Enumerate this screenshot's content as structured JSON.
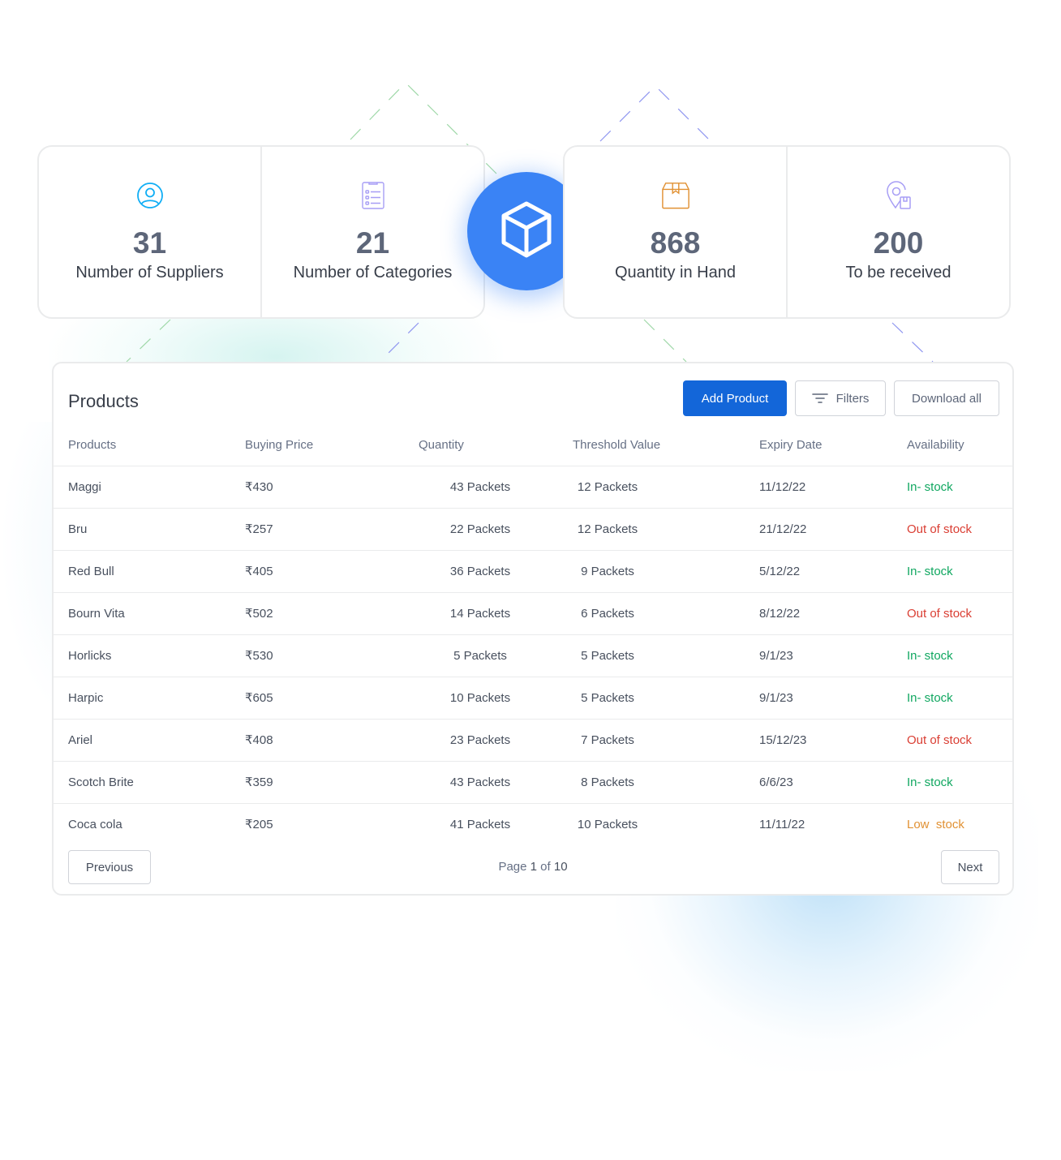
{
  "stats_left": [
    {
      "icon": "user-circle-icon",
      "value": "31",
      "label": "Number of Suppliers",
      "color": "#10aef5"
    },
    {
      "icon": "clipboard-list-icon",
      "value": "21",
      "label": "Number of Categories",
      "color": "#a79ef5"
    }
  ],
  "stats_right": [
    {
      "icon": "package-box-icon",
      "value": "868",
      "label": "Quantity in Hand",
      "color": "#e19133"
    },
    {
      "icon": "location-package-icon",
      "value": "200",
      "label": "To be received",
      "color": "#a79ef5"
    }
  ],
  "center_badge": {
    "icon": "cube-icon",
    "color": "#3a83f5"
  },
  "products": {
    "title": "Products",
    "buttons": {
      "add": "Add Product",
      "filters": "Filters",
      "download": "Download all"
    },
    "columns": [
      "Products",
      "Buying Price",
      "Quantity",
      "Threshold Value",
      "Expiry Date",
      "Availability"
    ],
    "rows": [
      {
        "name": "Maggi",
        "price": "₹430",
        "quantity": "43 Packets",
        "threshold": "12 Packets",
        "expiry": "11/12/22",
        "availability": "In- stock",
        "status": "in"
      },
      {
        "name": "Bru",
        "price": "₹257",
        "quantity": "22 Packets",
        "threshold": "12 Packets",
        "expiry": "21/12/22",
        "availability": "Out of stock",
        "status": "out"
      },
      {
        "name": "Red Bull",
        "price": "₹405",
        "quantity": "36 Packets",
        "threshold": "9 Packets",
        "expiry": "5/12/22",
        "availability": "In- stock",
        "status": "in"
      },
      {
        "name": "Bourn Vita",
        "price": "₹502",
        "quantity": "14 Packets",
        "threshold": "6 Packets",
        "expiry": "8/12/22",
        "availability": "Out of stock",
        "status": "out"
      },
      {
        "name": "Horlicks",
        "price": "₹530",
        "quantity": "5 Packets",
        "threshold": "5 Packets",
        "expiry": "9/1/23",
        "availability": "In- stock",
        "status": "in"
      },
      {
        "name": "Harpic",
        "price": "₹605",
        "quantity": "10 Packets",
        "threshold": "5 Packets",
        "expiry": "9/1/23",
        "availability": "In- stock",
        "status": "in"
      },
      {
        "name": "Ariel",
        "price": "₹408",
        "quantity": "23 Packets",
        "threshold": "7 Packets",
        "expiry": "15/12/23",
        "availability": "Out of stock",
        "status": "out"
      },
      {
        "name": "Scotch Brite",
        "price": "₹359",
        "quantity": "43 Packets",
        "threshold": "8 Packets",
        "expiry": "6/6/23",
        "availability": "In- stock",
        "status": "in"
      },
      {
        "name": "Coca cola",
        "price": "₹205",
        "quantity": "41 Packets",
        "threshold": "10 Packets",
        "expiry": "11/11/22",
        "availability": "Low  stock",
        "status": "low"
      }
    ],
    "status_colors": {
      "in": "#10a760",
      "out": "#da3e33",
      "low": "#e19133"
    },
    "pagination": {
      "previous": "Previous",
      "next": "Next",
      "page_prefix": "Page",
      "current_page": "1",
      "page_of": "of",
      "total_pages": "10"
    }
  },
  "accent_color": "#1366d9"
}
